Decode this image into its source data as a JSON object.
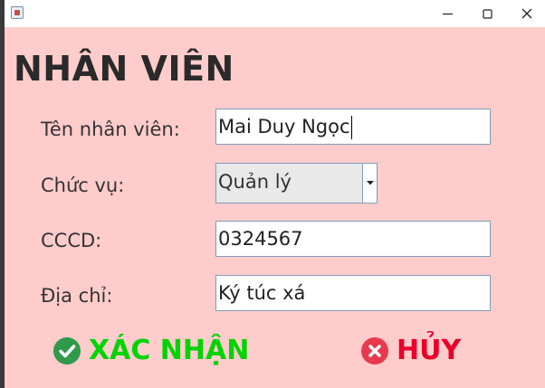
{
  "window": {
    "app_icon": "java-coffee-cup-icon",
    "controls": {
      "minimize": "minimize-icon",
      "maximize": "maximize-icon",
      "close": "close-icon"
    }
  },
  "form": {
    "title": "NHÂN VIÊN",
    "name_label": "Tên nhân viên:",
    "name_value": "Mai Duy Ngọc",
    "position_label": "Chức vụ:",
    "position_value": "Quản lý",
    "id_label": "CCCD:",
    "id_value": "0324567",
    "address_label": "Địa chỉ:",
    "address_value": "Ký túc xá"
  },
  "actions": {
    "confirm_label": "XÁC NHẬN",
    "confirm_icon": "check-circle-icon",
    "cancel_label": "HỦY",
    "cancel_icon": "x-circle-icon"
  },
  "colors": {
    "background": "#ffcccc",
    "confirm": "#00d400",
    "confirm_icon": "#2e9a4a",
    "cancel": "#e8002a",
    "cancel_icon": "#e8394d"
  }
}
